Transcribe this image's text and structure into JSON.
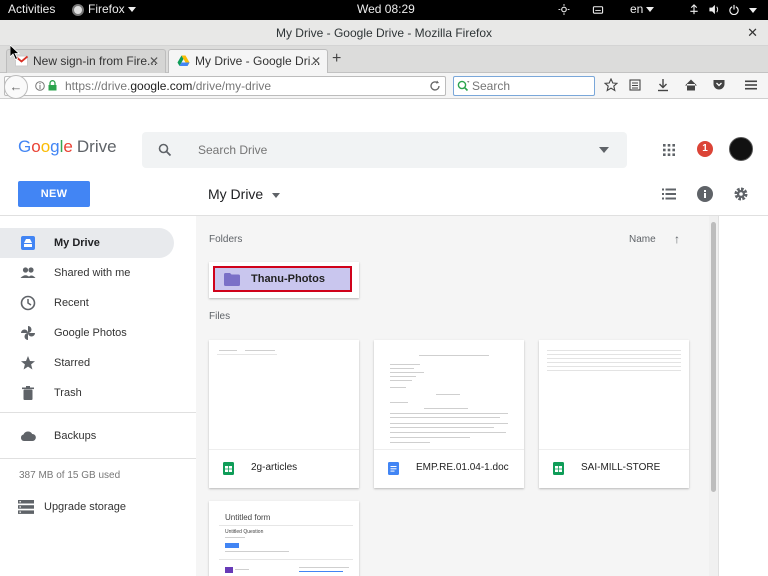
{
  "gnome": {
    "activities": "Activities",
    "app_name": "Firefox",
    "clock": "Wed 08:29",
    "lang": "en"
  },
  "browser": {
    "window_title": "My Drive - Google Drive - Mozilla Firefox",
    "tabs": [
      {
        "label": "New sign-in from Fire..."
      },
      {
        "label": "My Drive - Google Dri..."
      }
    ],
    "url_prefix": "https://drive.",
    "url_domain": "google.com",
    "url_path": "/drive/my-drive",
    "search_placeholder": "Search"
  },
  "drive": {
    "logo_google": "Google",
    "logo_drive": "Drive",
    "search_placeholder": "Search Drive",
    "notification_count": "1",
    "new_button": "NEW",
    "title": "My Drive",
    "sidebar": {
      "items": [
        {
          "label": "My Drive",
          "icon": "drive-icon",
          "active": true
        },
        {
          "label": "Shared with me",
          "icon": "people-icon"
        },
        {
          "label": "Recent",
          "icon": "clock-icon"
        },
        {
          "label": "Google Photos",
          "icon": "pinwheel-icon"
        },
        {
          "label": "Starred",
          "icon": "star-icon"
        },
        {
          "label": "Trash",
          "icon": "trash-icon"
        },
        {
          "label": "Backups",
          "icon": "cloud-icon"
        }
      ],
      "storage": "387 MB of 15 GB used",
      "upgrade": "Upgrade storage"
    },
    "sections": {
      "folders": "Folders",
      "files": "Files",
      "name_header": "Name"
    },
    "folders": [
      {
        "name": "Thanu-Photos"
      }
    ],
    "files": [
      {
        "name": "2g-articles",
        "type": "sheet"
      },
      {
        "name": "EMP.RE.01.04-1.doc",
        "type": "doc"
      },
      {
        "name": "SAI-MILL-STORE",
        "type": "sheet"
      },
      {
        "name": "",
        "type": "form"
      }
    ],
    "form_preview": {
      "title": "Untitled form",
      "question": "Untitled Question"
    }
  },
  "colors": {
    "accent_blue": "#4285f4",
    "sheet_green": "#0f9d58",
    "doc_blue": "#4285f4",
    "folder_highlight": "#c9c6ee",
    "highlight_border": "#d0021b",
    "badge_red": "#db4437"
  }
}
